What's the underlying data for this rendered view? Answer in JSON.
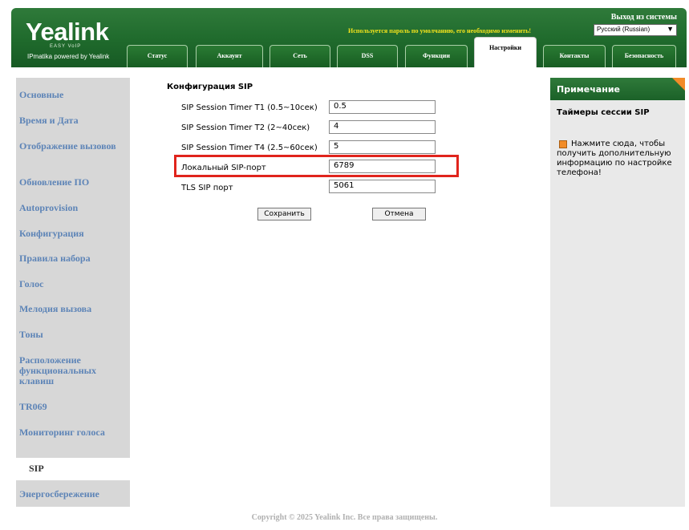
{
  "header": {
    "logo": "Yealink",
    "logo_sub": "EASY VoIP",
    "powered": "IPmatika powered by Yealink",
    "logout": "Выход из системы",
    "warning": "Используется пароль по умолчанию, его необходимо изменить!",
    "language": "Русский (Russian)"
  },
  "tabs": [
    {
      "label": "Статус"
    },
    {
      "label": "Аккаунт"
    },
    {
      "label": "Сеть"
    },
    {
      "label": "DSS"
    },
    {
      "label": "Функции"
    },
    {
      "label": "Настройки",
      "active": true
    },
    {
      "label": "Контакты"
    },
    {
      "label": "Безопасность"
    }
  ],
  "sidebar": {
    "items": [
      {
        "label": "Основные"
      },
      {
        "label": "Время и Дата"
      },
      {
        "label": "Отображение вызовов"
      },
      {
        "label": "Обновление ПО"
      },
      {
        "label": "Autoprovision"
      },
      {
        "label": "Конфигурация"
      },
      {
        "label": "Правила набора"
      },
      {
        "label": "Голос"
      },
      {
        "label": "Мелодия вызова"
      },
      {
        "label": "Тоны"
      },
      {
        "label": "Расположение функциональных клавиш"
      },
      {
        "label": "TR069"
      },
      {
        "label": "Мониторинг голоса"
      },
      {
        "label": "SIP",
        "active": true
      },
      {
        "label": "Энергосбережение"
      }
    ]
  },
  "main": {
    "title": "Конфигурация SIP",
    "rows": [
      {
        "label": "SIP Session Timer T1 (0.5~10сек)",
        "value": "0.5"
      },
      {
        "label": "SIP Session Timer T2 (2~40сек)",
        "value": "4"
      },
      {
        "label": "SIP Session Timer T4 (2.5~60сек)",
        "value": "5"
      },
      {
        "label": "Локальный SIP-порт",
        "value": "6789"
      },
      {
        "label": "TLS SIP порт",
        "value": "5061"
      }
    ],
    "save_label": "Сохранить",
    "cancel_label": "Отмена"
  },
  "note": {
    "title": "Примечание",
    "subtitle": "Таймеры сессии SIP",
    "text": "Нажмите сюда, чтобы получить дополнительную информацию по настройке телефона!"
  },
  "footer": "Copyright © 2025 Yealink Inc. Все права защищены.",
  "colors": {
    "header_green": "#1f6a2c",
    "sidebar_link": "#5d84b7",
    "highlight_red": "#e0241c",
    "note_accent": "#f28c28",
    "warning_yellow": "#f2e21c"
  }
}
